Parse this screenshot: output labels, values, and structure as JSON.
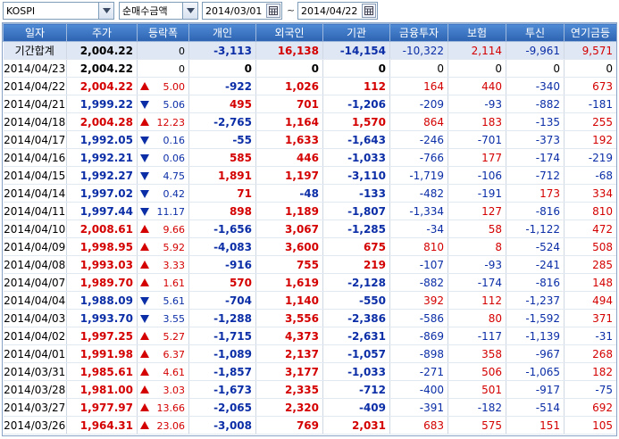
{
  "toolbar": {
    "market": "KOSPI",
    "type": "순매수금액",
    "start_date": "2014/03/01",
    "tilde": "~",
    "end_date": "2014/04/22"
  },
  "columns": [
    "일자",
    "주가",
    "등락폭",
    "개인",
    "외국인",
    "기관",
    "금융투자",
    "보험",
    "투신",
    "연기금등"
  ],
  "colors": {
    "up": "#d40000",
    "down": "#0b2ea7",
    "header": "#3a74c4",
    "sum_row": "#dfe7f4"
  },
  "rows": [
    {
      "date": "기간합계",
      "price": "2,004.22",
      "dir": "",
      "chg": "0",
      "ind": "-3,113",
      "frn": "16,138",
      "inst": "-14,154",
      "fin": "-10,322",
      "ins": "2,114",
      "trust": "-9,961",
      "pens": "9,571"
    },
    {
      "date": "2014/04/23",
      "price": "2,004.22",
      "dir": "",
      "chg": "0",
      "ind": "0",
      "frn": "0",
      "inst": "0",
      "fin": "0",
      "ins": "0",
      "trust": "0",
      "pens": "0"
    },
    {
      "date": "2014/04/22",
      "price": "2,004.22",
      "dir": "up",
      "chg": "5.00",
      "ind": "-922",
      "frn": "1,026",
      "inst": "112",
      "fin": "164",
      "ins": "440",
      "trust": "-340",
      "pens": "673"
    },
    {
      "date": "2014/04/21",
      "price": "1,999.22",
      "dir": "down",
      "chg": "5.06",
      "ind": "495",
      "frn": "701",
      "inst": "-1,206",
      "fin": "-209",
      "ins": "-93",
      "trust": "-882",
      "pens": "-181"
    },
    {
      "date": "2014/04/18",
      "price": "2,004.28",
      "dir": "up",
      "chg": "12.23",
      "ind": "-2,765",
      "frn": "1,164",
      "inst": "1,570",
      "fin": "864",
      "ins": "183",
      "trust": "-135",
      "pens": "255"
    },
    {
      "date": "2014/04/17",
      "price": "1,992.05",
      "dir": "down",
      "chg": "0.16",
      "ind": "-55",
      "frn": "1,633",
      "inst": "-1,643",
      "fin": "-246",
      "ins": "-701",
      "trust": "-373",
      "pens": "192"
    },
    {
      "date": "2014/04/16",
      "price": "1,992.21",
      "dir": "down",
      "chg": "0.06",
      "ind": "585",
      "frn": "446",
      "inst": "-1,033",
      "fin": "-766",
      "ins": "177",
      "trust": "-174",
      "pens": "-219"
    },
    {
      "date": "2014/04/15",
      "price": "1,992.27",
      "dir": "down",
      "chg": "4.75",
      "ind": "1,891",
      "frn": "1,197",
      "inst": "-3,110",
      "fin": "-1,719",
      "ins": "-106",
      "trust": "-712",
      "pens": "-68"
    },
    {
      "date": "2014/04/14",
      "price": "1,997.02",
      "dir": "down",
      "chg": "0.42",
      "ind": "71",
      "frn": "-48",
      "inst": "-133",
      "fin": "-482",
      "ins": "-191",
      "trust": "173",
      "pens": "334"
    },
    {
      "date": "2014/04/11",
      "price": "1,997.44",
      "dir": "down",
      "chg": "11.17",
      "ind": "898",
      "frn": "1,189",
      "inst": "-1,807",
      "fin": "-1,334",
      "ins": "127",
      "trust": "-816",
      "pens": "810"
    },
    {
      "date": "2014/04/10",
      "price": "2,008.61",
      "dir": "up",
      "chg": "9.66",
      "ind": "-1,656",
      "frn": "3,067",
      "inst": "-1,285",
      "fin": "-34",
      "ins": "58",
      "trust": "-1,122",
      "pens": "472"
    },
    {
      "date": "2014/04/09",
      "price": "1,998.95",
      "dir": "up",
      "chg": "5.92",
      "ind": "-4,083",
      "frn": "3,600",
      "inst": "675",
      "fin": "810",
      "ins": "8",
      "trust": "-524",
      "pens": "508"
    },
    {
      "date": "2014/04/08",
      "price": "1,993.03",
      "dir": "up",
      "chg": "3.33",
      "ind": "-916",
      "frn": "755",
      "inst": "219",
      "fin": "-107",
      "ins": "-93",
      "trust": "-241",
      "pens": "285"
    },
    {
      "date": "2014/04/07",
      "price": "1,989.70",
      "dir": "up",
      "chg": "1.61",
      "ind": "570",
      "frn": "1,619",
      "inst": "-2,128",
      "fin": "-882",
      "ins": "-174",
      "trust": "-816",
      "pens": "148"
    },
    {
      "date": "2014/04/04",
      "price": "1,988.09",
      "dir": "down",
      "chg": "5.61",
      "ind": "-704",
      "frn": "1,140",
      "inst": "-550",
      "fin": "392",
      "ins": "112",
      "trust": "-1,237",
      "pens": "494"
    },
    {
      "date": "2014/04/03",
      "price": "1,993.70",
      "dir": "down",
      "chg": "3.55",
      "ind": "-1,288",
      "frn": "3,556",
      "inst": "-2,386",
      "fin": "-586",
      "ins": "80",
      "trust": "-1,592",
      "pens": "371"
    },
    {
      "date": "2014/04/02",
      "price": "1,997.25",
      "dir": "up",
      "chg": "5.27",
      "ind": "-1,715",
      "frn": "4,373",
      "inst": "-2,631",
      "fin": "-869",
      "ins": "-117",
      "trust": "-1,139",
      "pens": "-31"
    },
    {
      "date": "2014/04/01",
      "price": "1,991.98",
      "dir": "up",
      "chg": "6.37",
      "ind": "-1,089",
      "frn": "2,137",
      "inst": "-1,057",
      "fin": "-898",
      "ins": "358",
      "trust": "-967",
      "pens": "268"
    },
    {
      "date": "2014/03/31",
      "price": "1,985.61",
      "dir": "up",
      "chg": "4.61",
      "ind": "-1,857",
      "frn": "3,177",
      "inst": "-1,033",
      "fin": "-271",
      "ins": "506",
      "trust": "-1,065",
      "pens": "182"
    },
    {
      "date": "2014/03/28",
      "price": "1,981.00",
      "dir": "up",
      "chg": "3.03",
      "ind": "-1,673",
      "frn": "2,335",
      "inst": "-712",
      "fin": "-400",
      "ins": "501",
      "trust": "-917",
      "pens": "-75"
    },
    {
      "date": "2014/03/27",
      "price": "1,977.97",
      "dir": "up",
      "chg": "13.66",
      "ind": "-2,065",
      "frn": "2,320",
      "inst": "-409",
      "fin": "-391",
      "ins": "-182",
      "trust": "-514",
      "pens": "692"
    },
    {
      "date": "2014/03/26",
      "price": "1,964.31",
      "dir": "up",
      "chg": "23.06",
      "ind": "-3,008",
      "frn": "769",
      "inst": "2,031",
      "fin": "683",
      "ins": "575",
      "trust": "151",
      "pens": "105"
    }
  ]
}
